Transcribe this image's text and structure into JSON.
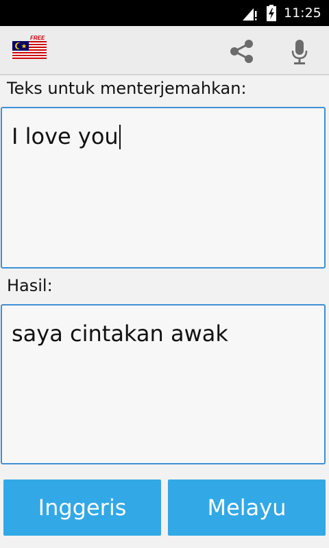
{
  "status_bar": {
    "time": "11:25",
    "icons": [
      "signal-icon",
      "battery-charging-icon"
    ]
  },
  "toolbar": {
    "logo_badge": "FREE",
    "icons": [
      "malaysia-flag-icon",
      "share-icon",
      "microphone-icon"
    ]
  },
  "source": {
    "label": "Teks untuk menterjemahkan:",
    "text": "I love you"
  },
  "result": {
    "label": "Hasil:",
    "text": "saya cintakan awak"
  },
  "languages": {
    "source_label": "Inggeris",
    "target_label": "Melayu"
  },
  "colors": {
    "accent": "#33a8e6",
    "border": "#3d8fd4",
    "flag_red": "#cc0001",
    "flag_blue": "#010066",
    "flag_yellow": "#ffcc00"
  }
}
